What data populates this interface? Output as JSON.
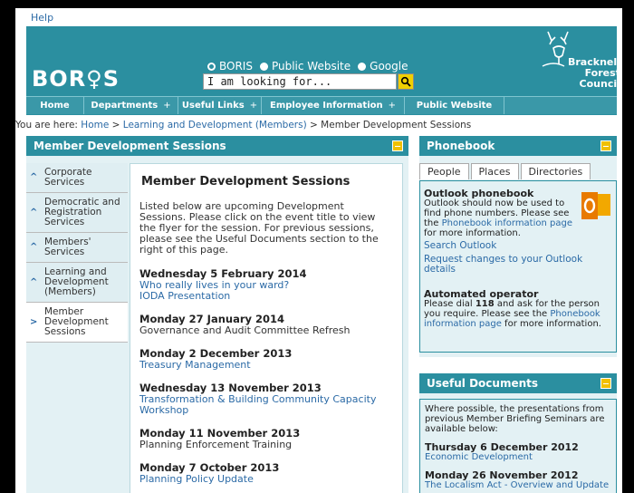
{
  "header": {
    "help": "Help",
    "logo": "BOR♀S",
    "radios": [
      {
        "label": "BORIS",
        "selected": true
      },
      {
        "label": "Public Website",
        "selected": false
      },
      {
        "label": "Google",
        "selected": false
      }
    ],
    "search_value": "I am looking for...",
    "council_lines": [
      "Bracknell",
      "Forest",
      "Council"
    ]
  },
  "nav": [
    {
      "label": "Home",
      "arrow": ""
    },
    {
      "label": "Departments",
      "arrow": "+"
    },
    {
      "label": "Useful Links",
      "arrow": "+"
    },
    {
      "label": "Employee Information",
      "arrow": "+"
    },
    {
      "label": "Public Website",
      "arrow": ""
    }
  ],
  "breadcrumb": {
    "prefix": "You are here: ",
    "home": "Home",
    "sep1": " > ",
    "learning": "Learning and Development (Members)",
    "sep2": " > ",
    "current": "Member Development Sessions"
  },
  "main": {
    "panel_title": "Member Development Sessions",
    "left_nav": [
      {
        "label": "Corporate\nServices",
        "chevron": "^",
        "active": false
      },
      {
        "label": "Democratic and\nRegistration\nServices",
        "chevron": "^",
        "active": false
      },
      {
        "label": "Members'\nServices",
        "chevron": "^",
        "active": false
      },
      {
        "label": "Learning and\nDevelopment\n(Members)",
        "chevron": "^",
        "active": false
      },
      {
        "label": "Member\nDevelopment\nSessions",
        "chevron": ">",
        "active": true
      }
    ],
    "heading": "Member Development Sessions",
    "intro": "Listed below are upcoming Development Sessions. Please click on the event title to view the flyer for the session. For previous sessions, please see the Useful Documents section to the right of this page.",
    "events": [
      {
        "date": "Wednesday 5 February 2014",
        "items": [
          {
            "text": "Who really lives in your ward?",
            "link": true
          },
          {
            "text": "IODA Presentation",
            "link": true
          }
        ]
      },
      {
        "date": "Monday 27 January 2014",
        "items": [
          {
            "text": "Governance and Audit Committee Refresh",
            "link": false
          }
        ]
      },
      {
        "date": "Monday 2 December 2013",
        "items": [
          {
            "text": "Treasury Management",
            "link": true
          }
        ]
      },
      {
        "date": "Wednesday 13 November 2013",
        "items": [
          {
            "text": "Transformation & Building Community Capacity Workshop",
            "link": true
          }
        ]
      },
      {
        "date": "Monday 11 November 2013",
        "items": [
          {
            "text": "Planning Enforcement Training",
            "link": false
          }
        ]
      },
      {
        "date": "Monday 7 October 2013",
        "items": [
          {
            "text": "Planning Policy Update",
            "link": true
          }
        ]
      }
    ]
  },
  "phonebook": {
    "title": "Phonebook",
    "tabs": [
      "People",
      "Places",
      "Directories"
    ],
    "outlook_title": "Outlook phonebook",
    "outlook_text_1": "Outlook should now be used to find phone numbers. Please see the ",
    "outlook_link": "Phonebook information page",
    "outlook_text_2": " for more information.",
    "search_outlook": "Search Outlook",
    "request_changes": "Request changes to your Outlook details",
    "operator_title": "Automated operator",
    "operator_text_1": "Please dial ",
    "operator_number": "118",
    "operator_text_2": " and ask for the person you require. Please see the ",
    "operator_link": "Phonebook information page",
    "operator_text_3": " for more information."
  },
  "useful_docs": {
    "title": "Useful Documents",
    "intro": "Where possible, the presentations from previous Member Briefing Seminars are available below:",
    "entries": [
      {
        "date": "Thursday 6 December 2012",
        "item": "Economic Development"
      },
      {
        "date": "Monday 26 November 2012",
        "item": "The Localism Act - Overview and Update"
      }
    ]
  },
  "colors": {
    "teal": "#2b8fa0",
    "link": "#2b6aa6",
    "accent_yellow": "#f0c000",
    "panel_bg": "#e3f1f4"
  }
}
